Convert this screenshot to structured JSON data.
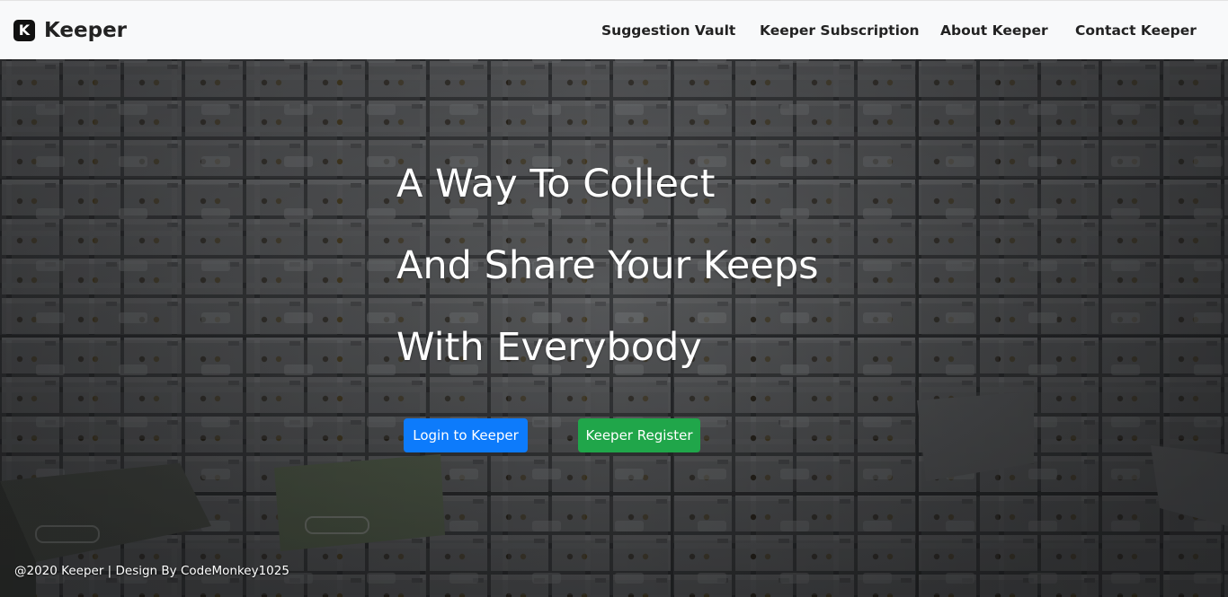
{
  "brand": {
    "name": "Keeper",
    "logo_icon": "keeper-k-logo",
    "logo_letter": "K"
  },
  "nav": {
    "items": [
      {
        "label": "Suggestion Vault"
      },
      {
        "label": "Keeper Subscription"
      },
      {
        "label": "About Keeper"
      },
      {
        "label": "Contact Keeper"
      }
    ]
  },
  "hero": {
    "lines": [
      "A Way To Collect",
      "And Share Your Keeps",
      "With Everybody"
    ],
    "buttons": {
      "login": {
        "label": "Login to Keeper",
        "color": "#0d7bfb"
      },
      "register": {
        "label": "Keeper Register",
        "color": "#20a64a"
      }
    },
    "background": "safe-deposit-boxes-photo"
  },
  "footer": {
    "text": "@2020 Keeper | Design By CodeMonkey1025"
  }
}
